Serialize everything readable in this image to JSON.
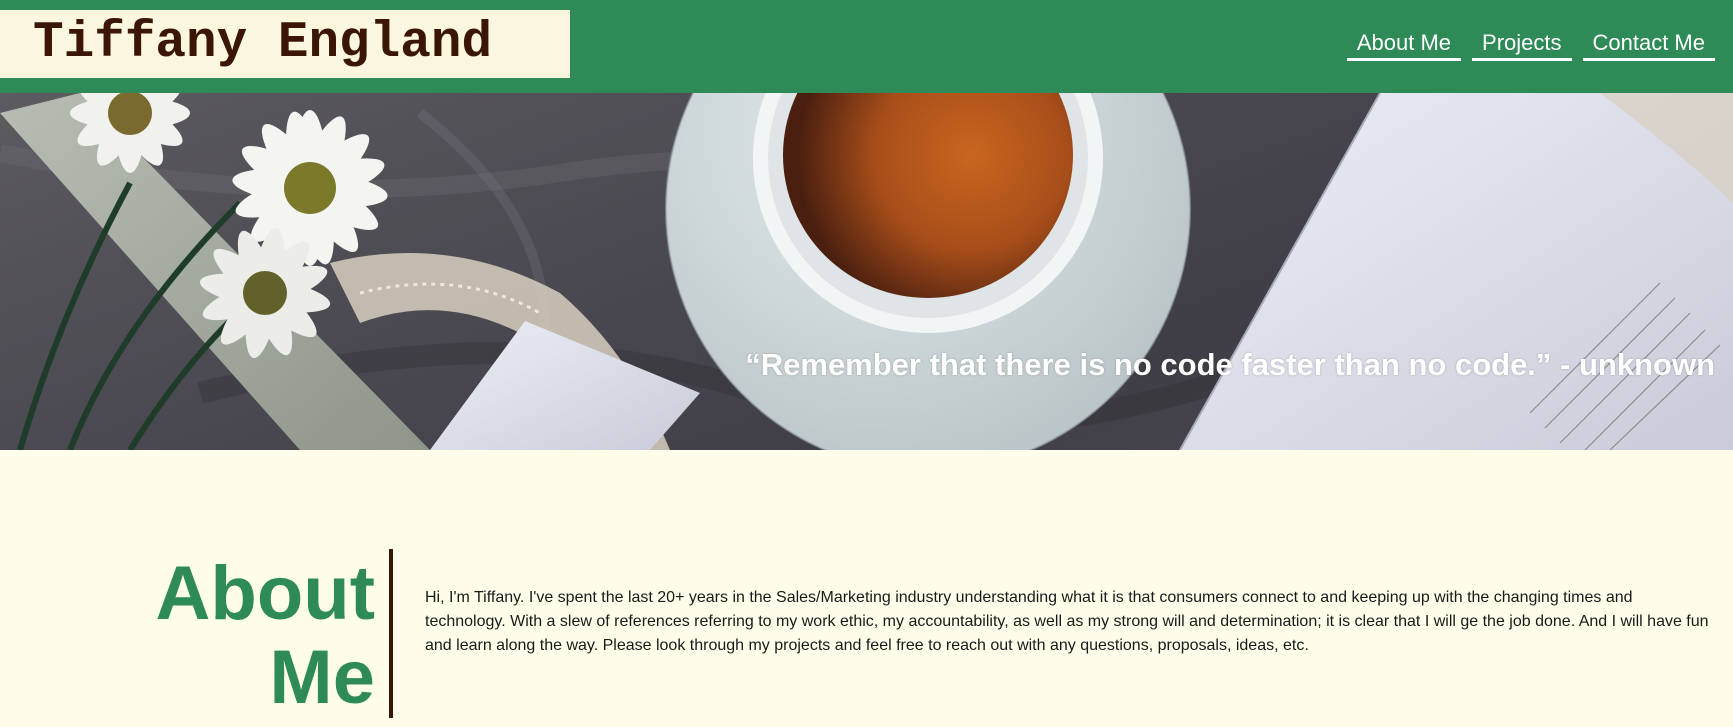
{
  "site": {
    "logo_text": "Tiffany England"
  },
  "nav": {
    "items": [
      {
        "label": "About Me"
      },
      {
        "label": "Projects"
      },
      {
        "label": "Contact Me"
      }
    ]
  },
  "hero": {
    "quote": "“Remember that there is no code faster than no code.” - unknown",
    "image_subject": "flat-lay of tea cup, daisies, lace and open books"
  },
  "about": {
    "title": "About Me",
    "body": "Hi, I'm Tiffany. I've spent the last 20+ years in the Sales/Marketing industry understanding what it is that consumers connect to and keeping up with the changing times and technology. With a slew of references referring to my work ethic, my accountability, as well as my strong will and determination; it is clear that I will ge the job done. And I will have fun and learn along the way. Please look through my projects and feel free to reach out with any questions, proposals, ideas, etc."
  },
  "colors": {
    "header_green": "#2e8b57",
    "logo_bg": "#fbf7df",
    "logo_text": "#3b1607",
    "page_bg": "#fffeea",
    "about_title": "#2e8b57",
    "divider": "#3b1607"
  }
}
